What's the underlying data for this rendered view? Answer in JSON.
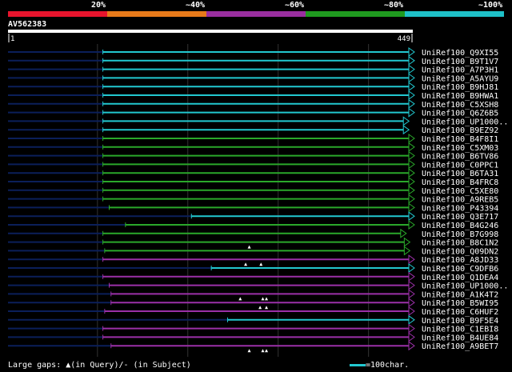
{
  "identity_legend": [
    {
      "label": "20%",
      "color": "#e8142d"
    },
    {
      "label": "~40%",
      "color": "#e87a1a"
    },
    {
      "label": "~60%",
      "color": "#9a2fa0"
    },
    {
      "label": "~80%",
      "color": "#1f9a1f"
    },
    {
      "label": "~100%",
      "color": "#1ec0c8"
    }
  ],
  "query": {
    "name": "AV562383",
    "start": "1",
    "end": "449",
    "length": 449
  },
  "hits": [
    {
      "name": "UniRef100_Q9XI55",
      "start": 106,
      "end": 449,
      "color": "cyan",
      "gaps": []
    },
    {
      "name": "UniRef100_B9T1V7",
      "start": 106,
      "end": 449,
      "color": "cyan",
      "gaps": []
    },
    {
      "name": "UniRef100_A7P3H1",
      "start": 106,
      "end": 449,
      "color": "cyan",
      "gaps": []
    },
    {
      "name": "UniRef100_A5AYU9",
      "start": 106,
      "end": 449,
      "color": "cyan",
      "gaps": []
    },
    {
      "name": "UniRef100_B9HJ81",
      "start": 106,
      "end": 449,
      "color": "cyan",
      "gaps": []
    },
    {
      "name": "UniRef100_B9HWA1",
      "start": 106,
      "end": 449,
      "color": "cyan",
      "gaps": []
    },
    {
      "name": "UniRef100_C5XSH8",
      "start": 106,
      "end": 449,
      "color": "cyan",
      "gaps": []
    },
    {
      "name": "UniRef100_Q6Z6B5",
      "start": 106,
      "end": 449,
      "color": "cyan",
      "gaps": []
    },
    {
      "name": "UniRef100_UP1000..",
      "start": 106,
      "end": 443,
      "color": "cyan",
      "gaps": []
    },
    {
      "name": "UniRef100_B9EZ92",
      "start": 106,
      "end": 443,
      "color": "cyan",
      "gaps": []
    },
    {
      "name": "UniRef100_B4F8I1",
      "start": 106,
      "end": 449,
      "color": "green",
      "gaps": []
    },
    {
      "name": "UniRef100_C5XM03",
      "start": 106,
      "end": 449,
      "color": "green",
      "gaps": []
    },
    {
      "name": "UniRef100_B6TV86",
      "start": 106,
      "end": 449,
      "color": "green",
      "gaps": []
    },
    {
      "name": "UniRef100_C0PPC1",
      "start": 106,
      "end": 449,
      "color": "green",
      "gaps": []
    },
    {
      "name": "UniRef100_B6TA31",
      "start": 106,
      "end": 449,
      "color": "green",
      "gaps": []
    },
    {
      "name": "UniRef100_B4FRC8",
      "start": 106,
      "end": 449,
      "color": "green",
      "gaps": []
    },
    {
      "name": "UniRef100_C5XE80",
      "start": 106,
      "end": 449,
      "color": "green",
      "gaps": []
    },
    {
      "name": "UniRef100_A9REB5",
      "start": 106,
      "end": 449,
      "color": "green",
      "gaps": []
    },
    {
      "name": "UniRef100_P43394",
      "start": 113,
      "end": 449,
      "color": "green",
      "gaps": []
    },
    {
      "name": "UniRef100_Q3E717",
      "start": 204,
      "end": 449,
      "color": "cyan",
      "gaps": []
    },
    {
      "name": "UniRef100_B4G246",
      "start": 131,
      "end": 449,
      "color": "green",
      "gaps": []
    },
    {
      "name": "UniRef100_B7G998",
      "start": 106,
      "end": 440,
      "color": "green",
      "gaps": []
    },
    {
      "name": "UniRef100_B8C1N2",
      "start": 106,
      "end": 444,
      "color": "green",
      "gaps": [
        268
      ]
    },
    {
      "name": "UniRef100_Q09DN2",
      "start": 108,
      "end": 444,
      "color": "green",
      "gaps": []
    },
    {
      "name": "UniRef100_A8JD33",
      "start": 106,
      "end": 449,
      "color": "purple",
      "gaps": [
        264,
        281
      ]
    },
    {
      "name": "UniRef100_C9DFB6",
      "start": 226,
      "end": 449,
      "color": "cyan",
      "gaps": []
    },
    {
      "name": "UniRef100_Q1DEA4",
      "start": 106,
      "end": 449,
      "color": "purple",
      "gaps": []
    },
    {
      "name": "UniRef100_UP1000..",
      "start": 113,
      "end": 449,
      "color": "purple",
      "gaps": []
    },
    {
      "name": "UniRef100_A1K4T2",
      "start": 115,
      "end": 449,
      "color": "purple",
      "gaps": [
        258,
        283,
        287
      ]
    },
    {
      "name": "UniRef100_B5WI95",
      "start": 115,
      "end": 449,
      "color": "purple",
      "gaps": [
        280,
        287
      ]
    },
    {
      "name": "UniRef100_C6HUF2",
      "start": 108,
      "end": 449,
      "color": "purple",
      "gaps": []
    },
    {
      "name": "UniRef100_B9F5E4",
      "start": 244,
      "end": 449,
      "color": "cyan",
      "gaps": []
    },
    {
      "name": "UniRef100_C1EBI8",
      "start": 106,
      "end": 449,
      "color": "purple",
      "gaps": []
    },
    {
      "name": "UniRef100_B4UE84",
      "start": 106,
      "end": 449,
      "color": "purple",
      "gaps": []
    },
    {
      "name": "UniRef100_A9BET7",
      "start": 115,
      "end": 449,
      "color": "purple",
      "gaps": [
        268,
        283,
        287
      ]
    }
  ],
  "colors": {
    "cyan": "#22c8d0",
    "green": "#2aa82a",
    "purple": "#9b30a8",
    "query_line": "#0b1f5a",
    "grid": "#333333"
  },
  "footer": {
    "large_gaps_text": "Large gaps: ▲(in Query)/- (in Subject)",
    "scale_text": "=100char."
  }
}
